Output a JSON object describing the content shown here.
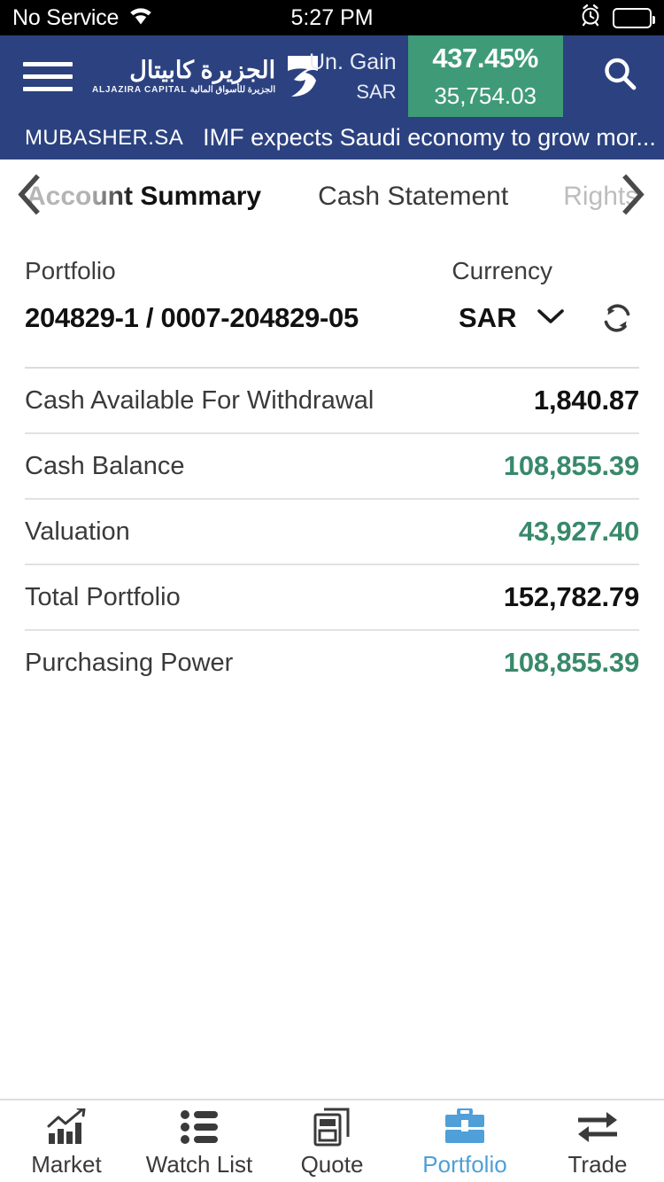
{
  "status_bar": {
    "carrier": "No Service",
    "wifi_icon": "wifi-icon",
    "time": "5:27 PM",
    "alarm_icon": "alarm-clock-icon",
    "battery_icon": "battery-icon",
    "battery_level_pct": 70
  },
  "header": {
    "menu_icon": "hamburger-menu-icon",
    "brand_arabic": "الجزيرة كابيتال",
    "brand_subtitle": "ALJAZIRA CAPITAL  الجزيرة للأسواق المالية",
    "brand_mark_icon": "aljazira-swoosh-logo-icon",
    "gain_label": "Un. Gain",
    "currency_label": "SAR",
    "gain_percent": "437.45%",
    "gain_value": "35,754.03",
    "gain_badge_color": "#3f9b77",
    "header_color": "#2c4280",
    "search_icon": "search-icon"
  },
  "ticker": {
    "source": "MUBASHER.SA",
    "headline": "IMF expects Saudi economy to grow mor..."
  },
  "tabs": {
    "prev_icon": "chevron-left-icon",
    "next_icon": "chevron-right-icon",
    "items": [
      {
        "label": "Account Summary",
        "active": true
      },
      {
        "label": "Cash Statement",
        "active": false
      },
      {
        "label": "Rights",
        "active": false
      }
    ]
  },
  "selector": {
    "portfolio_label": "Portfolio",
    "currency_label": "Currency",
    "portfolio_value": "204829-1 / 0007-204829-05",
    "currency_value": "SAR",
    "caret_icon": "chevron-down-icon",
    "refresh_icon": "refresh-sync-icon"
  },
  "summary": {
    "rows": [
      {
        "label": "Cash Available For Withdrawal",
        "value": "1,840.87",
        "color": "dark"
      },
      {
        "label": "Cash Balance",
        "value": "108,855.39",
        "color": "green"
      },
      {
        "label": "Valuation",
        "value": "43,927.40",
        "color": "green"
      },
      {
        "label": "Total Portfolio",
        "value": "152,782.79",
        "color": "dark"
      },
      {
        "label": "Purchasing Power",
        "value": "108,855.39",
        "color": "green"
      }
    ],
    "green_color": "#38896b",
    "dark_color": "#111111"
  },
  "bottom_nav": {
    "active_color": "#4f9fd8",
    "items": [
      {
        "label": "Market",
        "icon": "market-chart-icon",
        "active": false
      },
      {
        "label": "Watch List",
        "icon": "list-icon",
        "active": false
      },
      {
        "label": "Quote",
        "icon": "quote-cards-icon",
        "active": false
      },
      {
        "label": "Portfolio",
        "icon": "briefcase-icon",
        "active": true
      },
      {
        "label": "Trade",
        "icon": "exchange-arrows-icon",
        "active": false
      }
    ]
  }
}
